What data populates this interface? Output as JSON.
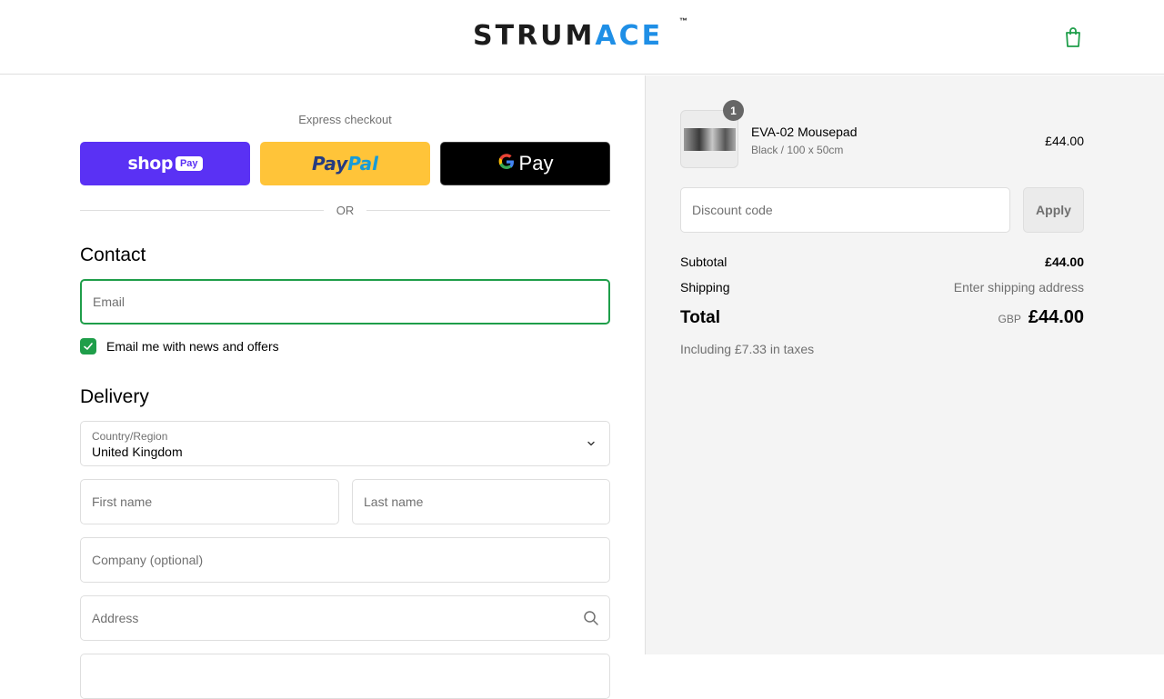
{
  "header": {
    "logo_main": "STRUM",
    "logo_accent": "ACE",
    "logo_tm": "™",
    "cart_icon": "shopping-bag-icon"
  },
  "express": {
    "label": "Express checkout",
    "shop_pay": {
      "word": "shop",
      "badge": "Pay"
    },
    "paypal": {
      "part1": "Pay",
      "part2": "Pal"
    },
    "gpay": {
      "g": "G",
      "word": "Pay"
    },
    "or_label": "OR"
  },
  "contact": {
    "title": "Contact",
    "email_placeholder": "Email",
    "newsletter_checked": true,
    "newsletter_label": "Email me with news and offers"
  },
  "delivery": {
    "title": "Delivery",
    "country_label": "Country/Region",
    "country_value": "United Kingdom",
    "first_name_placeholder": "First name",
    "last_name_placeholder": "Last name",
    "company_placeholder": "Company (optional)",
    "address_placeholder": "Address"
  },
  "order": {
    "items": [
      {
        "quantity": "1",
        "name": "EVA-02 Mousepad",
        "variant": "Black / 100 x 50cm",
        "price": "£44.00"
      }
    ],
    "discount_placeholder": "Discount code",
    "apply_label": "Apply",
    "subtotal_label": "Subtotal",
    "subtotal_value": "£44.00",
    "shipping_label": "Shipping",
    "shipping_value": "Enter shipping address",
    "total_label": "Total",
    "currency": "GBP",
    "total_value": "£44.00",
    "taxes_note": "Including £7.33 in taxes"
  },
  "colors": {
    "accent_green": "#1f9e4a",
    "shop_pay_purple": "#5a31f4",
    "paypal_yellow": "#ffc439",
    "logo_blue": "#1f8fe6"
  }
}
